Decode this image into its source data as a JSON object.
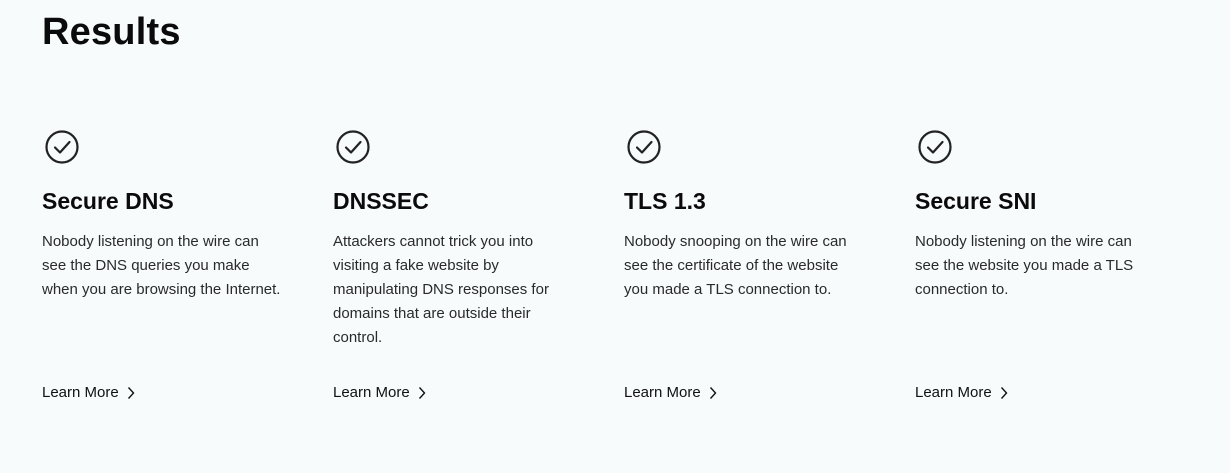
{
  "page": {
    "title": "Results"
  },
  "cards": [
    {
      "icon": "check-circle-icon",
      "title": "Secure DNS",
      "description": "Nobody listening on the wire can see the DNS queries you make when you are browsing the Internet.",
      "link_label": "Learn More"
    },
    {
      "icon": "check-circle-icon",
      "title": "DNSSEC",
      "description": "Attackers cannot trick you into visiting a fake website by manipulating DNS responses for domains that are outside their control.",
      "link_label": "Learn More"
    },
    {
      "icon": "check-circle-icon",
      "title": "TLS 1.3",
      "description": "Nobody snooping on the wire can see the certificate of the website you made a TLS connection to.",
      "link_label": "Learn More"
    },
    {
      "icon": "check-circle-icon",
      "title": "Secure SNI",
      "description": "Nobody listening on the wire can see the website you made a TLS connection to.",
      "link_label": "Learn More"
    }
  ],
  "colors": {
    "background": "#f7fbfc",
    "text": "#111111",
    "icon_stroke": "#222222"
  }
}
